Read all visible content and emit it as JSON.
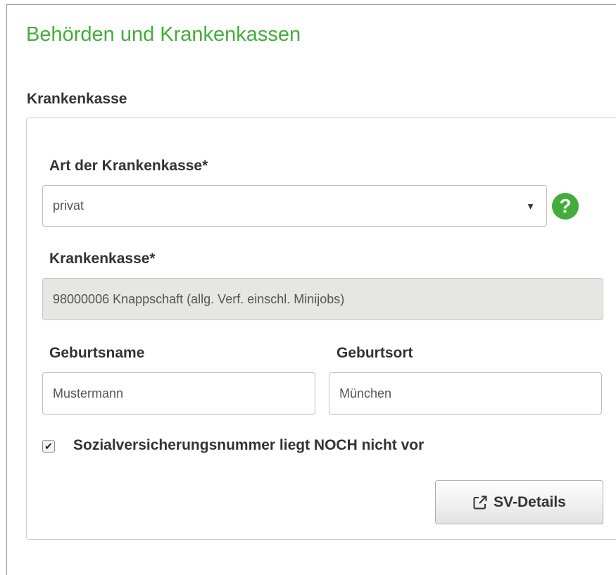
{
  "page": {
    "title": "Behörden und Krankenkassen"
  },
  "section": {
    "label": "Krankenkasse"
  },
  "art_krankenkasse": {
    "label": "Art der Krankenkasse*",
    "value": "privat",
    "arrow": "▼",
    "help_icon": "question-circle-icon",
    "help_glyph": "?"
  },
  "krankenkasse": {
    "label": "Krankenkasse*",
    "value": "98000006 Knappschaft (allg. Verf. einschl. Minijobs)"
  },
  "geburtsname": {
    "label": "Geburtsname",
    "value": "Mustermann"
  },
  "geburtsort": {
    "label": "Geburtsort",
    "value": "München"
  },
  "sv_checkbox": {
    "label": "Sozialversicherungsnummer liegt NOCH nicht vor",
    "checked": true,
    "mark": "✔"
  },
  "sv_button": {
    "label": "SV-Details",
    "icon": "external-link-icon"
  },
  "colors": {
    "accent": "#43ad3c",
    "disabled_bg": "#e6e6e3"
  }
}
